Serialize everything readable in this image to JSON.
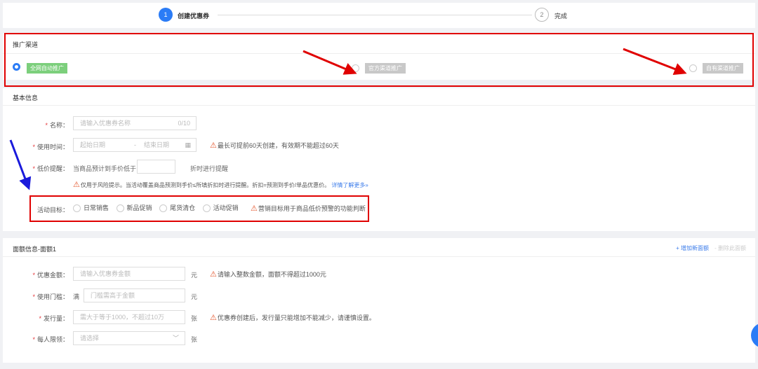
{
  "steps": [
    {
      "num": "1",
      "label": "创建优惠券"
    },
    {
      "num": "2",
      "label": "完成"
    }
  ],
  "channel": {
    "title": "推广渠道",
    "options": [
      {
        "label": "全网自动推广",
        "selected": true
      },
      {
        "label": "官方渠道推广",
        "selected": false
      },
      {
        "label": "自有渠道推广",
        "selected": false
      }
    ]
  },
  "basic": {
    "title": "基本信息",
    "name": {
      "label": "名称：",
      "placeholder": "请输入优惠券名称",
      "counter": "0/10"
    },
    "time": {
      "label": "使用时间：",
      "start": "起始日期",
      "sep": "-",
      "end": "结束日期",
      "warning": "最长可提前60天创建，有效期不能超过60天"
    },
    "lowprice": {
      "label": "低价提醒：",
      "prefix": "当商品预计到手价低于",
      "suffix": "折时进行提醒",
      "note": "仅用于风险提示。当活动覆盖商品预测到手价≤所填折扣时进行提醒。折扣=预测到手价/单品优惠价。",
      "link": "详情了解更多»"
    },
    "goal": {
      "label": "活动目标：",
      "options": [
        "日常销售",
        "新品促销",
        "尾货清仓",
        "活动促销"
      ],
      "warning": "营销目标用于商品低价预警的功能判断"
    }
  },
  "face": {
    "title": "面额信息-面额1",
    "add": "+ 增加新面额",
    "remove": "- 删除此面额",
    "amount": {
      "label": "优惠金额：",
      "placeholder": "请输入优惠券金额",
      "unit": "元",
      "warning": "请输入整数金额，面额不得超过1000元"
    },
    "threshold": {
      "label": "使用门槛：",
      "prefix": "满",
      "placeholder": "门槛需高于金额",
      "unit": "元"
    },
    "quantity": {
      "label": "发行量：",
      "placeholder": "需大于等于1000，不超过10万",
      "unit": "张",
      "warning": "优惠券创建后，发行量只能增加不能减少，请谨慎设置。"
    },
    "limit": {
      "label": "每人限领：",
      "placeholder": "请选择",
      "unit": "张"
    }
  },
  "colors": {
    "primary": "#2b7cf6",
    "green": "#7ccf7c",
    "annotation_red": "#e00000",
    "annotation_blue": "#1a1adb"
  }
}
